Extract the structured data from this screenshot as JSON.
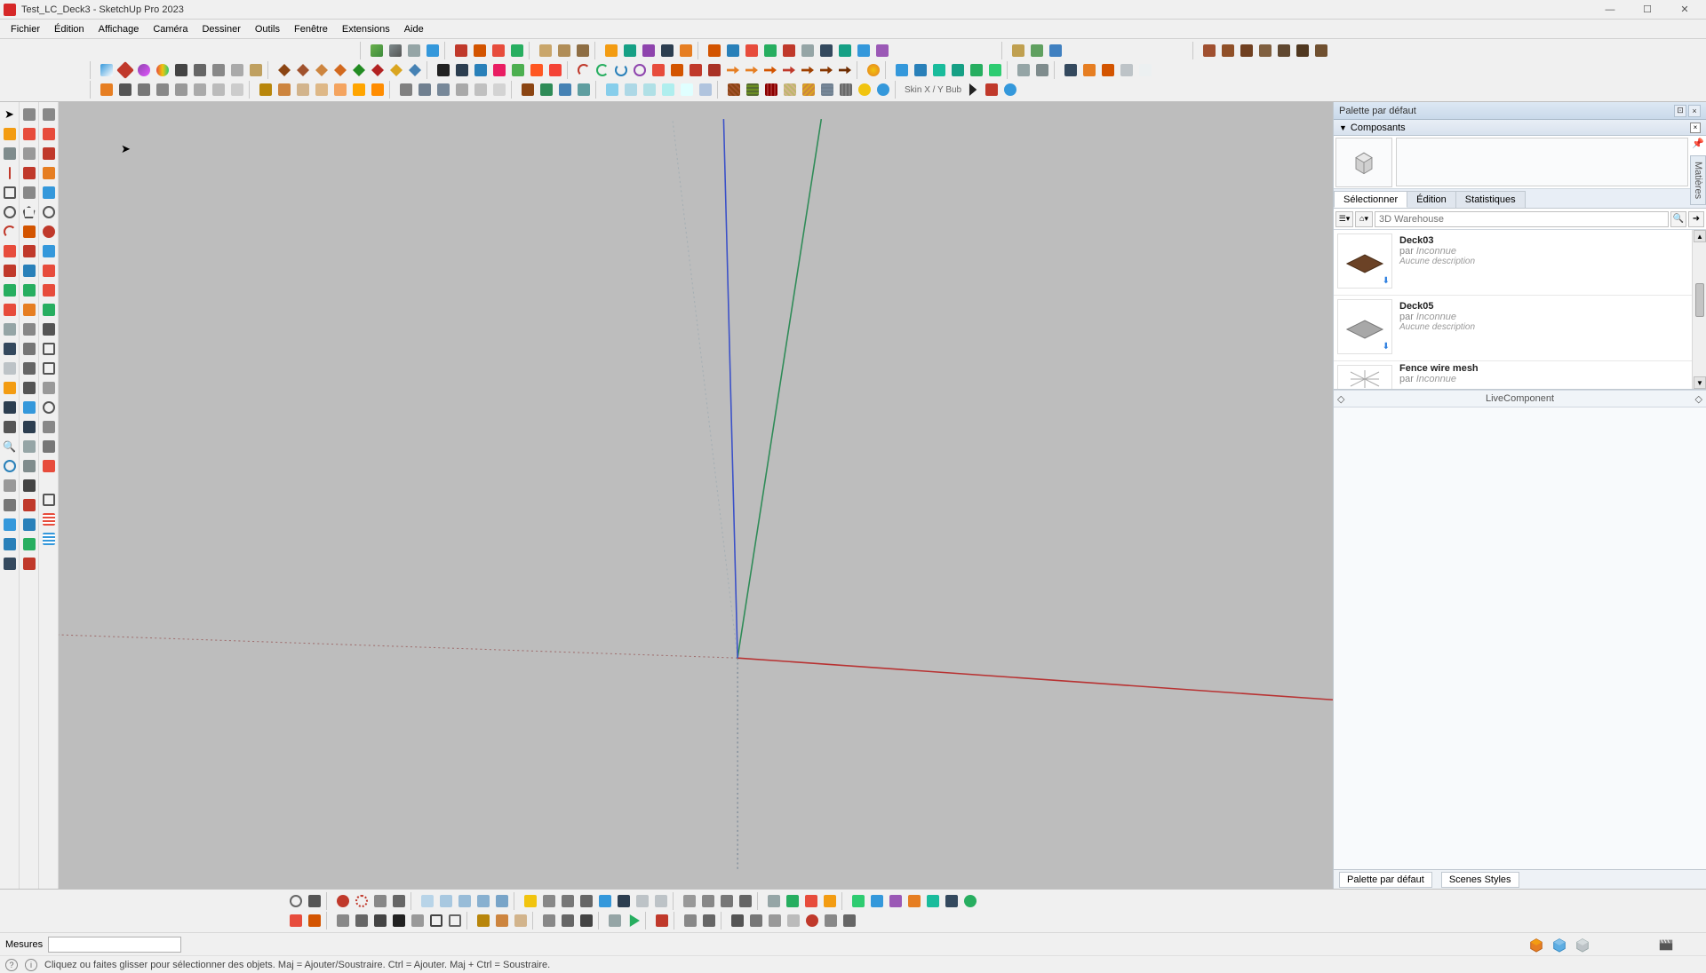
{
  "app": {
    "title": "Test_LC_Deck3 - SketchUp Pro 2023"
  },
  "menu": {
    "items": [
      "Fichier",
      "Édition",
      "Affichage",
      "Caméra",
      "Dessiner",
      "Outils",
      "Fenêtre",
      "Extensions",
      "Aide"
    ]
  },
  "right_panel": {
    "title": "Palette par défaut",
    "section": "Composants",
    "tabs": {
      "select": "Sélectionner",
      "edit": "Édition",
      "stats": "Statistiques"
    },
    "search_placeholder": "3D Warehouse",
    "items": [
      {
        "name": "Deck03",
        "by": "par",
        "author": "Inconnue",
        "desc": "Aucune description"
      },
      {
        "name": "Deck05",
        "by": "par",
        "author": "Inconnue",
        "desc": "Aucune description"
      },
      {
        "name": "Fence wire mesh",
        "by": "par",
        "author": "Inconnue",
        "desc": ""
      }
    ],
    "live": "LiveComponent",
    "footer": {
      "a": "Palette par défaut",
      "b": "Scenes Styles"
    }
  },
  "side_tab": "Matières",
  "status": {
    "measure_label": "Mesures",
    "hint": "Cliquez ou faites glisser pour sélectionner des objets. Maj = Ajouter/Soustraire. Ctrl = Ajouter. Maj + Ctrl = Soustraire."
  },
  "win": {
    "min": "—",
    "max": "☐",
    "close": "✕"
  }
}
